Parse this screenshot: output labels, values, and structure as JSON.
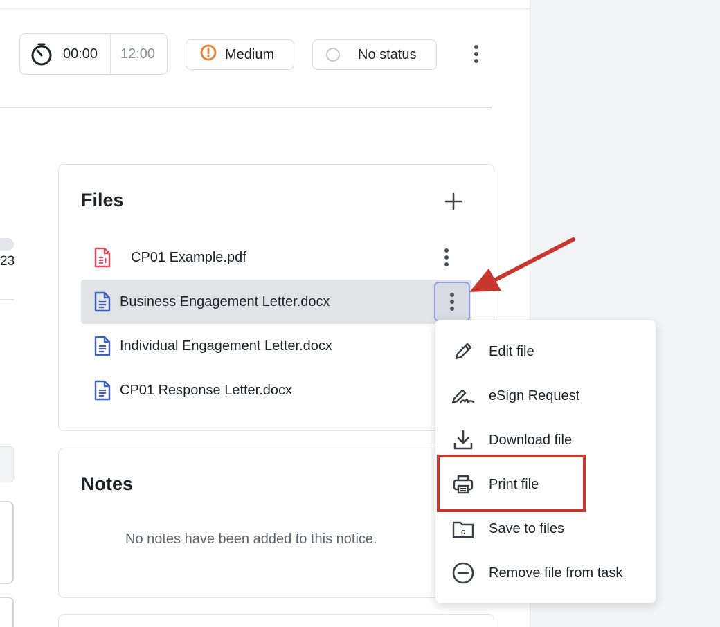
{
  "timer": {
    "elapsed": "00:00",
    "estimate": "12:00"
  },
  "priority": {
    "label": "Medium",
    "color": "#e8843a"
  },
  "status": {
    "label": "No status"
  },
  "left_fragment": {
    "text": "23"
  },
  "files": {
    "title": "Files",
    "items": [
      {
        "name": "CP01 Example.pdf",
        "type": "pdf",
        "icon": "pdf-file-icon",
        "color": "#e04a5a"
      },
      {
        "name": "Business Engagement Letter.docx",
        "type": "docx",
        "icon": "doc-file-icon",
        "color": "#3d5fb8",
        "selected": true
      },
      {
        "name": "Individual Engagement Letter.docx",
        "type": "docx",
        "icon": "doc-file-icon",
        "color": "#3d5fb8"
      },
      {
        "name": "CP01 Response Letter.docx",
        "type": "docx",
        "icon": "doc-file-icon",
        "color": "#3d5fb8"
      }
    ]
  },
  "notes": {
    "title": "Notes",
    "empty_text": "No notes have been added to this notice."
  },
  "context_menu": {
    "items": [
      {
        "label": "Edit file",
        "icon": "pencil-icon"
      },
      {
        "label": "eSign Request",
        "icon": "signature-icon"
      },
      {
        "label": "Download file",
        "icon": "download-icon"
      },
      {
        "label": "Print file",
        "icon": "printer-icon",
        "highlighted": true
      },
      {
        "label": "Save to files",
        "icon": "folder-icon"
      },
      {
        "label": "Remove file from task",
        "icon": "minus-circle-icon"
      }
    ]
  },
  "annotation": {
    "color": "#c8372d"
  }
}
